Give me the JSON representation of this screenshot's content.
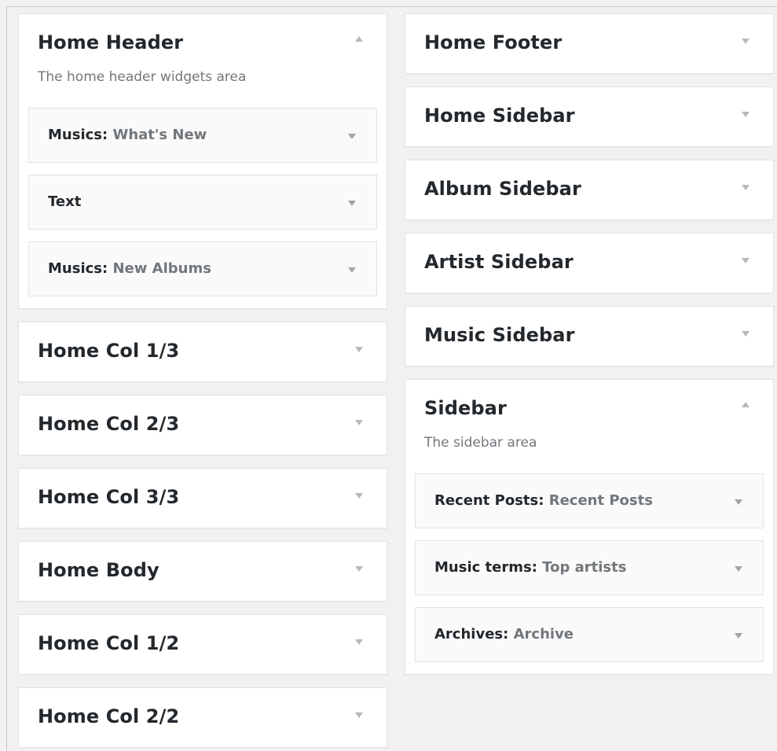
{
  "left_column": {
    "home_header": {
      "title": "Home Header",
      "description": "The home header widgets area",
      "widgets": [
        {
          "type": "Musics:",
          "name": "What's New"
        },
        {
          "type": "Text",
          "name": ""
        },
        {
          "type": "Musics:",
          "name": "New Albums"
        }
      ]
    },
    "areas": [
      {
        "title": "Home Col 1/3"
      },
      {
        "title": "Home Col 2/3"
      },
      {
        "title": "Home Col 3/3"
      },
      {
        "title": "Home Body"
      },
      {
        "title": "Home Col 1/2"
      },
      {
        "title": "Home Col 2/2"
      }
    ]
  },
  "right_column": {
    "areas": [
      {
        "title": "Home Footer"
      },
      {
        "title": "Home Sidebar"
      },
      {
        "title": "Album Sidebar"
      },
      {
        "title": "Artist Sidebar"
      },
      {
        "title": "Music Sidebar"
      }
    ],
    "sidebar": {
      "title": "Sidebar",
      "description": "The sidebar area",
      "widgets": [
        {
          "type": "Recent Posts:",
          "name": "Recent Posts"
        },
        {
          "type": "Music terms:",
          "name": "Top artists"
        },
        {
          "type": "Archives:",
          "name": "Archive"
        }
      ]
    }
  },
  "icons": {
    "collapsed": "triangle-down-icon",
    "expanded": "triangle-up-icon"
  },
  "colors": {
    "background": "#f1f1f1",
    "panel": "#ffffff",
    "widget": "#fafafa",
    "title_text": "#23282d",
    "muted_text": "#72777c",
    "arrow": "#b4b9be"
  }
}
